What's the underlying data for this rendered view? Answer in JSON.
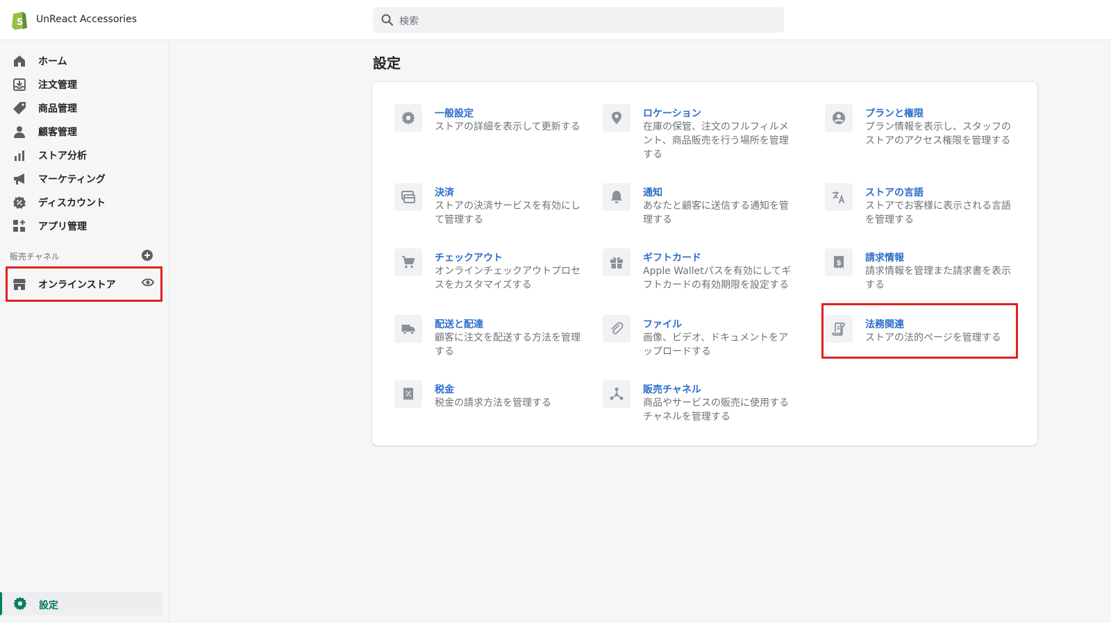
{
  "app": {
    "store_name": "UnReact Accessories"
  },
  "search": {
    "placeholder": "検索"
  },
  "sidebar": {
    "items": [
      {
        "label": "ホーム",
        "icon": "home-icon"
      },
      {
        "label": "注文管理",
        "icon": "orders-icon"
      },
      {
        "label": "商品管理",
        "icon": "tag-icon"
      },
      {
        "label": "顧客管理",
        "icon": "customer-icon"
      },
      {
        "label": "ストア分析",
        "icon": "analytics-icon"
      },
      {
        "label": "マーケティング",
        "icon": "megaphone-icon"
      },
      {
        "label": "ディスカウント",
        "icon": "discount-icon"
      },
      {
        "label": "アプリ管理",
        "icon": "apps-icon"
      }
    ],
    "sales_channels_label": "販売チャネル",
    "online_store_label": "オンラインストア",
    "settings_label": "設定"
  },
  "main": {
    "title": "設定",
    "settings": [
      {
        "title": "一般設定",
        "desc": "ストアの詳細を表示して更新する",
        "icon": "gear-icon"
      },
      {
        "title": "ロケーション",
        "desc": "在庫の保管、注文のフルフィルメント、商品販売を行う場所を管理する",
        "icon": "location-pin-icon"
      },
      {
        "title": "プランと権限",
        "desc": "プラン情報を表示し、スタッフのストアのアクセス権限を管理する",
        "icon": "user-circle-icon"
      },
      {
        "title": "決済",
        "desc": "ストアの決済サービスを有効にして管理する",
        "icon": "payment-icon"
      },
      {
        "title": "通知",
        "desc": "あなたと顧客に送信する通知を管理する",
        "icon": "bell-icon"
      },
      {
        "title": "ストアの言語",
        "desc": "ストアでお客様に表示される言語を管理する",
        "icon": "translate-icon"
      },
      {
        "title": "チェックアウト",
        "desc": "オンラインチェックアウトプロセスをカスタマイズする",
        "icon": "cart-icon"
      },
      {
        "title": "ギフトカード",
        "desc": "Apple Walletパスを有効にしてギフトカードの有効期限を設定する",
        "icon": "gift-icon"
      },
      {
        "title": "請求情報",
        "desc": "請求情報を管理また請求書を表示する",
        "icon": "bill-icon"
      },
      {
        "title": "配送と配達",
        "desc": "顧客に注文を配送する方法を管理する",
        "icon": "truck-icon"
      },
      {
        "title": "ファイル",
        "desc": "画像、ビデオ、ドキュメントをアップロードする",
        "icon": "paperclip-icon"
      },
      {
        "title": "法務関連",
        "desc": "ストアの法的ページを管理する",
        "icon": "legal-icon"
      },
      {
        "title": "税金",
        "desc": "税金の請求方法を管理する",
        "icon": "tax-icon"
      },
      {
        "title": "販売チャネル",
        "desc": "商品やサービスの販売に使用するチャネルを管理する",
        "icon": "channels-icon"
      }
    ]
  },
  "colors": {
    "link": "#2c6ecb",
    "accent": "#008060",
    "highlight": "#e02020"
  }
}
